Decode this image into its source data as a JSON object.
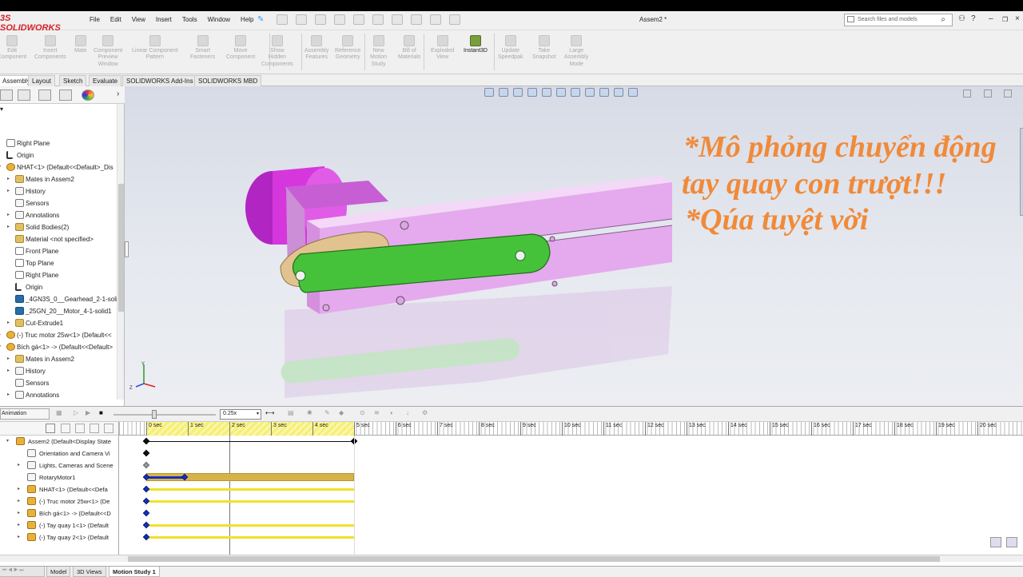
{
  "app": {
    "brand_prefix": "3S",
    "brand_name": "SOLIDWORKS",
    "document_title": "Assem2 *"
  },
  "menu": [
    "File",
    "Edit",
    "View",
    "Insert",
    "Tools",
    "Window",
    "Help"
  ],
  "search": {
    "placeholder": "Search files and models"
  },
  "commands": [
    {
      "label": "Edit\nComponent",
      "enabled": false
    },
    {
      "label": "Insert\nComponents",
      "enabled": false
    },
    {
      "label": "Mate",
      "enabled": false
    },
    {
      "label": "Component\nPreview\nWindow",
      "enabled": false
    },
    {
      "label": "Linear Component\nPattern",
      "enabled": false
    },
    {
      "label": "Smart\nFasteners",
      "enabled": false
    },
    {
      "label": "Move\nComponent",
      "enabled": false
    },
    {
      "label": "Show\nHidden\nComponents",
      "enabled": false
    },
    {
      "label": "Assembly\nFeatures",
      "enabled": false
    },
    {
      "label": "Reference\nGeometry",
      "enabled": false
    },
    {
      "label": "New\nMotion\nStudy",
      "enabled": false
    },
    {
      "label": "Bill of\nMaterials",
      "enabled": false
    },
    {
      "label": "Exploded\nView",
      "enabled": false
    },
    {
      "label": "Instant3D",
      "enabled": true
    },
    {
      "label": "Update\nSpeedpak",
      "enabled": false
    },
    {
      "label": "Take\nSnapshot",
      "enabled": false
    },
    {
      "label": "Large\nAssembly\nMode",
      "enabled": false
    }
  ],
  "tabs": [
    "Assembly",
    "Layout",
    "Sketch",
    "Evaluate",
    "SOLIDWORKS Add-Ins",
    "SOLIDWORKS MBD"
  ],
  "active_tab": "Assembly",
  "tree": [
    {
      "label": "Right Plane",
      "icon": "plane-icon",
      "indent": 0,
      "expand": false
    },
    {
      "label": "Origin",
      "icon": "origin-icon",
      "indent": 0,
      "expand": false
    },
    {
      "label": "NHAT<1> (Default<<Default>_Dis",
      "icon": "assembly-icon",
      "indent": 0,
      "expand": true,
      "open": true
    },
    {
      "label": "Mates in Assem2",
      "icon": "mates-icon",
      "indent": 1,
      "expand": true
    },
    {
      "label": "History",
      "icon": "history-icon",
      "indent": 1,
      "expand": true
    },
    {
      "label": "Sensors",
      "icon": "sensor-icon",
      "indent": 1,
      "expand": false
    },
    {
      "label": "Annotations",
      "icon": "annotation-icon",
      "indent": 1,
      "expand": true
    },
    {
      "label": "Solid Bodies(2)",
      "icon": "solid-bodies-icon",
      "indent": 1,
      "expand": true
    },
    {
      "label": "Material <not specified>",
      "icon": "material-icon",
      "indent": 1,
      "expand": false
    },
    {
      "label": "Front Plane",
      "icon": "plane-icon",
      "indent": 1,
      "expand": false
    },
    {
      "label": "Top Plane",
      "icon": "plane-icon",
      "indent": 1,
      "expand": false
    },
    {
      "label": "Right Plane",
      "icon": "plane-icon",
      "indent": 1,
      "expand": false
    },
    {
      "label": "Origin",
      "icon": "origin-icon",
      "indent": 1,
      "expand": false
    },
    {
      "label": "_4GN3S_0__Gearhead_2-1-solid",
      "icon": "part-icon",
      "indent": 1,
      "expand": false
    },
    {
      "label": "_25GN_20__Motor_4-1-solid1",
      "icon": "part-icon",
      "indent": 1,
      "expand": false
    },
    {
      "label": "Cut-Extrude1",
      "icon": "feature-icon",
      "indent": 1,
      "expand": true
    },
    {
      "label": "(-) Truc motor 25w<1> (Default<<",
      "icon": "assembly-icon",
      "indent": 0,
      "expand": true
    },
    {
      "label": "Bích gá<1> -> (Default<<Default>",
      "icon": "assembly-icon",
      "indent": 0,
      "expand": true,
      "open": true
    },
    {
      "label": "Mates in Assem2",
      "icon": "mates-icon",
      "indent": 1,
      "expand": true
    },
    {
      "label": "History",
      "icon": "history-icon",
      "indent": 1,
      "expand": true
    },
    {
      "label": "Sensors",
      "icon": "sensor-icon",
      "indent": 1,
      "expand": false
    },
    {
      "label": "Annotations",
      "icon": "annotation-icon",
      "indent": 1,
      "expand": true
    }
  ],
  "overlay_text": [
    "*Mô phỏng chuyển động",
    "tay quay con trượt!!!",
    "*Qúa tuyệt vời"
  ],
  "overlay_color": "#f08a3a",
  "motion": {
    "study_type": "Animation",
    "speed": "0.25x",
    "time_ticks": [
      "0 sec",
      "1 sec",
      "2 sec",
      "3 sec",
      "4 sec",
      "5 sec",
      "6 sec",
      "7 sec",
      "8 sec",
      "9 sec",
      "10 sec",
      "11 sec",
      "12 sec",
      "13 sec",
      "14 sec",
      "15 sec",
      "16 sec",
      "17 sec",
      "18 sec",
      "19 sec",
      "20 sec"
    ],
    "rows": [
      {
        "label": "Assem2 (Default<Display State",
        "icon": "assembly-icon",
        "indent": 0,
        "expand": "open"
      },
      {
        "label": "Orientation and Camera Vi",
        "icon": "camera-icon",
        "indent": 1,
        "expand": ""
      },
      {
        "label": "Lights, Cameras and Scene",
        "icon": "lights-icon",
        "indent": 1,
        "expand": "closed"
      },
      {
        "label": "RotaryMotor1",
        "icon": "motor-icon",
        "indent": 1,
        "expand": ""
      },
      {
        "label": "NHAT<1> (Default<<Defa",
        "icon": "assembly-icon",
        "indent": 1,
        "expand": "closed"
      },
      {
        "label": "(-) Truc motor 25w<1> (De",
        "icon": "assembly-icon",
        "indent": 1,
        "expand": "closed"
      },
      {
        "label": "Bích gá<1> -> (Default<<D",
        "icon": "assembly-icon",
        "indent": 1,
        "expand": "closed"
      },
      {
        "label": "(-) Tay quay 1<1> (Default",
        "icon": "assembly-icon",
        "indent": 1,
        "expand": "closed"
      },
      {
        "label": "(-) Tay quay 2<1> (Default",
        "icon": "assembly-icon",
        "indent": 1,
        "expand": "closed"
      }
    ]
  },
  "bottom_tabs": [
    "Model",
    "3D Views",
    "Motion Study 1"
  ],
  "active_bottom_tab": "Motion Study 1",
  "colors": {
    "motor": "#cc2fd6",
    "rails": "#e7a8ef",
    "link": "#46c23a",
    "crank": "#e2c28e",
    "timeline_bar": "#f0e12b",
    "key": "#1430c0"
  }
}
